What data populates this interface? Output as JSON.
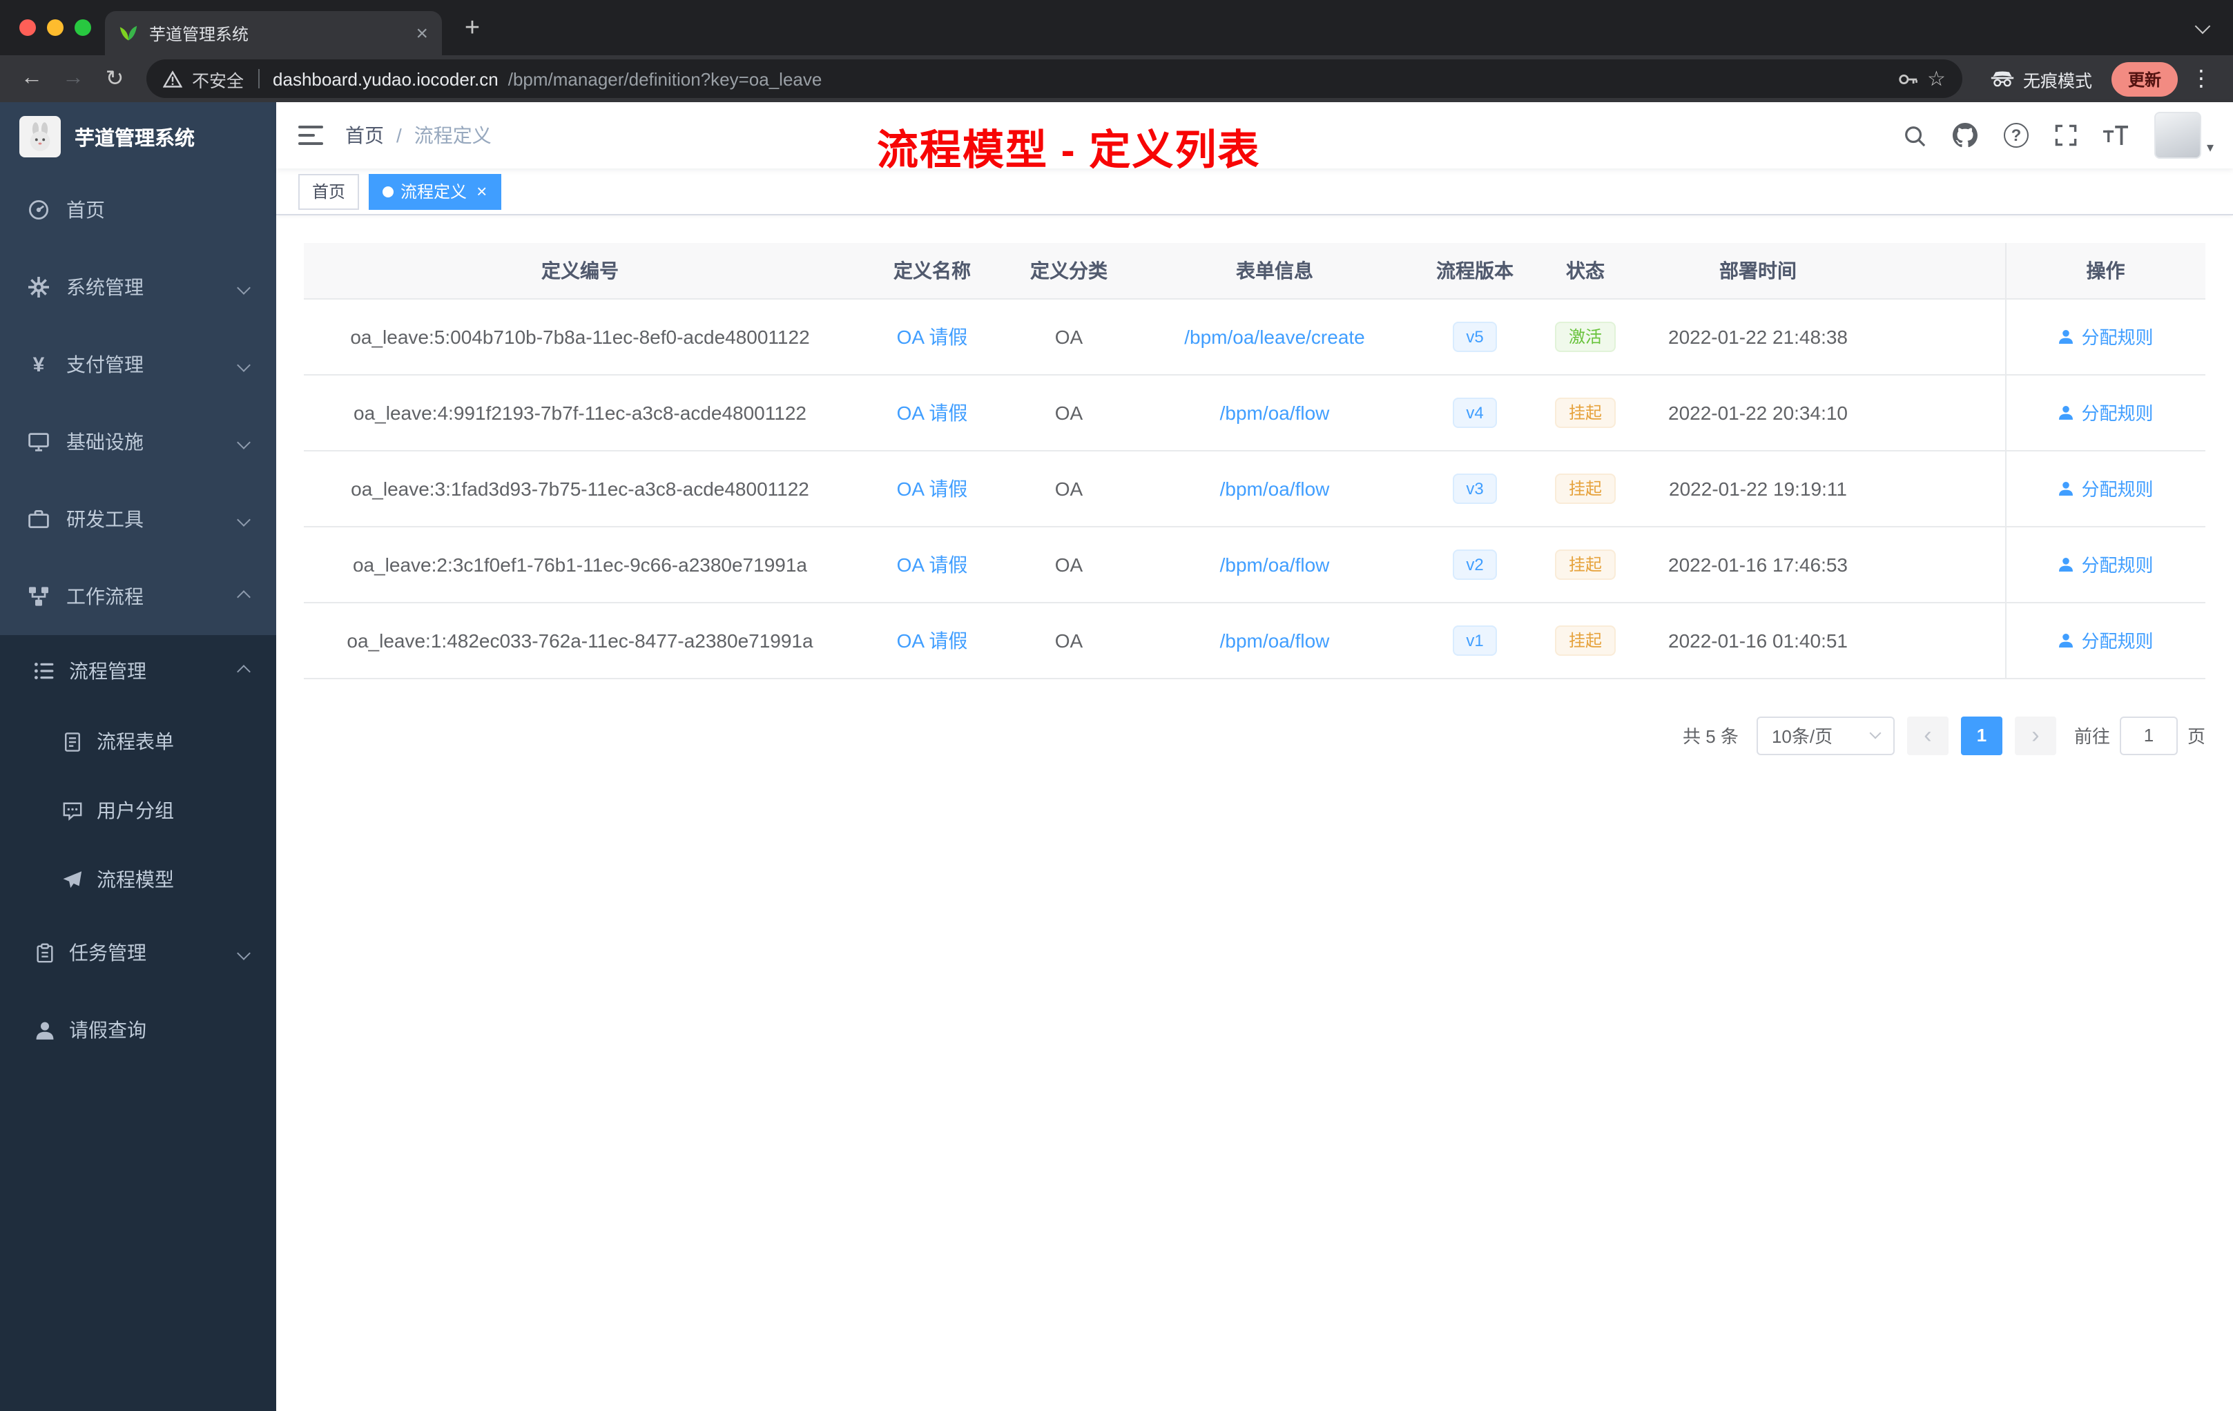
{
  "glyphs": {
    "close": "×",
    "new_tab": "+",
    "back": "←",
    "forward": "→",
    "reload": "↻",
    "star": "☆",
    "menu_dots": "⋮",
    "question": "?",
    "caret_down": "▾",
    "prev": "‹",
    "next": "›"
  },
  "browser": {
    "tab_title": "芋道管理系统",
    "security_label": "不安全",
    "url_host": "dashboard.yudao.iocoder.cn",
    "url_path": "/bpm/manager/definition?key=oa_leave",
    "incognito_label": "无痕模式",
    "update_label": "更新"
  },
  "sidebar": {
    "logo_title": "芋道管理系统",
    "items": [
      {
        "label": "首页"
      },
      {
        "label": "系统管理"
      },
      {
        "label": "支付管理"
      },
      {
        "label": "基础设施"
      },
      {
        "label": "研发工具"
      },
      {
        "label": "工作流程"
      }
    ],
    "workflow_menu": {
      "process_management": {
        "label": "流程管理",
        "children": [
          {
            "label": "流程表单"
          },
          {
            "label": "用户分组"
          },
          {
            "label": "流程模型"
          }
        ]
      },
      "task_management": {
        "label": "任务管理"
      },
      "leave_query": {
        "label": "请假查询"
      }
    }
  },
  "header": {
    "breadcrumb": [
      "首页",
      "流程定义"
    ],
    "breadcrumb_sep": "/",
    "annotation": "流程模型 - 定义列表"
  },
  "tags": [
    {
      "label": "首页",
      "active": false
    },
    {
      "label": "流程定义",
      "active": true
    }
  ],
  "table": {
    "columns": [
      "定义编号",
      "定义名称",
      "定义分类",
      "表单信息",
      "流程版本",
      "状态",
      "部署时间",
      "操作"
    ],
    "action_label": "分配规则",
    "rows": [
      {
        "id": "oa_leave:5:004b710b-7b8a-11ec-8ef0-acde48001122",
        "name": "OA 请假",
        "category": "OA",
        "form": "/bpm/oa/leave/create",
        "version": "v5",
        "status": "激活",
        "time": "2022-01-22 21:48:38"
      },
      {
        "id": "oa_leave:4:991f2193-7b7f-11ec-a3c8-acde48001122",
        "name": "OA 请假",
        "category": "OA",
        "form": "/bpm/oa/flow",
        "version": "v4",
        "status": "挂起",
        "time": "2022-01-22 20:34:10"
      },
      {
        "id": "oa_leave:3:1fad3d93-7b75-11ec-a3c8-acde48001122",
        "name": "OA 请假",
        "category": "OA",
        "form": "/bpm/oa/flow",
        "version": "v3",
        "status": "挂起",
        "time": "2022-01-22 19:19:11"
      },
      {
        "id": "oa_leave:2:3c1f0ef1-76b1-11ec-9c66-a2380e71991a",
        "name": "OA 请假",
        "category": "OA",
        "form": "/bpm/oa/flow",
        "version": "v2",
        "status": "挂起",
        "time": "2022-01-16 17:46:53"
      },
      {
        "id": "oa_leave:1:482ec033-762a-11ec-8477-a2380e71991a",
        "name": "OA 请假",
        "category": "OA",
        "form": "/bpm/oa/flow",
        "version": "v1",
        "status": "挂起",
        "time": "2022-01-16 01:40:51"
      }
    ]
  },
  "pagination": {
    "total": "共 5 条",
    "page_size": "10条/页",
    "current_page": "1",
    "goto_label": "前往",
    "goto_value": "1",
    "page_label": "页"
  },
  "colors": {
    "accent_blue": "#409eff",
    "annotation_red": "#f70505",
    "success_green": "#67c23a",
    "warning_orange": "#e6a23c",
    "sidebar_bg": "#304156",
    "submenu_bg": "#1f2d3d"
  }
}
